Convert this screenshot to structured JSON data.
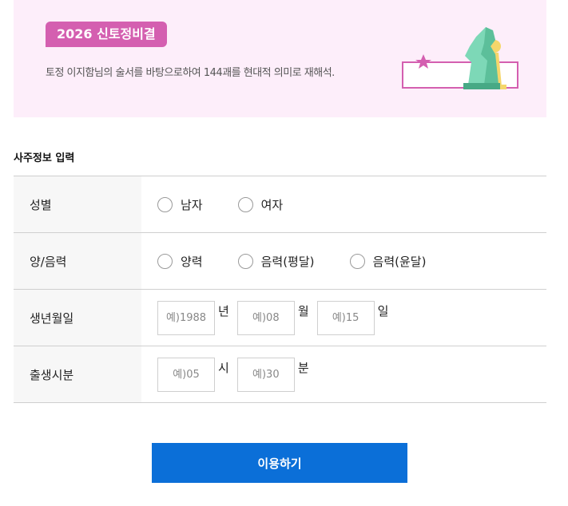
{
  "banner": {
    "badge": "2026 신토정비결",
    "description": "토정 이지함님의 술서를 바탕으로하여 144괘를 현대적 의미로 재해석."
  },
  "section_title": "사주정보 입력",
  "rows": {
    "gender": {
      "label": "성별",
      "options": [
        "남자",
        "여자"
      ]
    },
    "calendar": {
      "label": "양/음력",
      "options": [
        "양력",
        "음력(평달)",
        "음력(윤달)"
      ]
    },
    "birthdate": {
      "label": "생년월일",
      "year_placeholder": "예)1988",
      "year_unit": "년",
      "month_placeholder": "예)08",
      "month_unit": "월",
      "day_placeholder": "예)15",
      "day_unit": "일"
    },
    "birthtime": {
      "label": "출생시분",
      "hour_placeholder": "예)05",
      "hour_unit": "시",
      "minute_placeholder": "예)30",
      "minute_unit": "분"
    }
  },
  "submit_label": "이용하기",
  "colors": {
    "banner_bg": "#fdeefa",
    "badge": "#d45fb0",
    "button": "#0b6fd8"
  }
}
